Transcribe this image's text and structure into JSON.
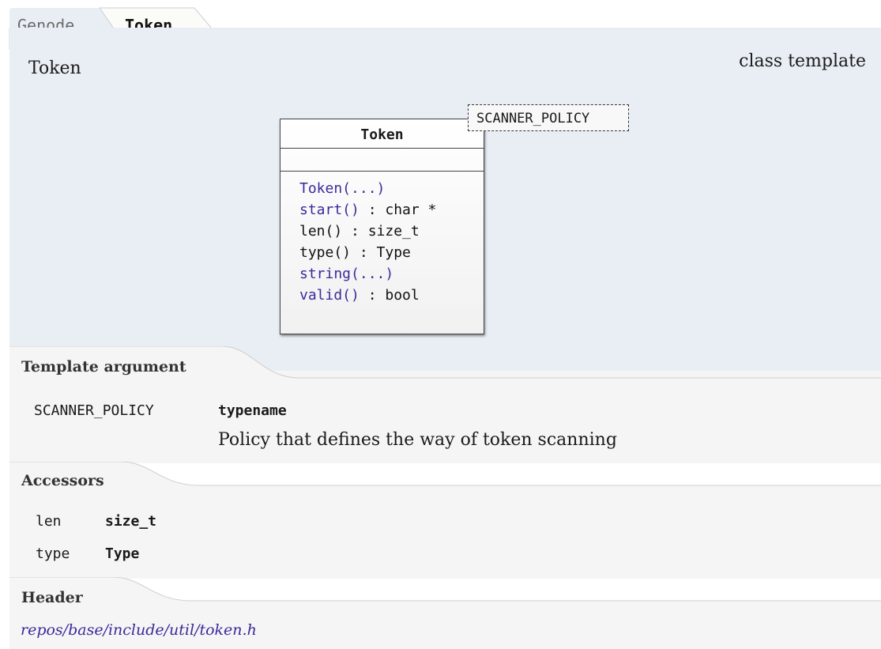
{
  "breadcrumb": {
    "parent": "Genode",
    "current": "Token"
  },
  "class": {
    "name": "Token",
    "kind": "class template"
  },
  "uml": {
    "title": "Token",
    "template_parameter": "SCANNER_POLICY",
    "operations": [
      {
        "name": "Token(...)",
        "type": "",
        "linked": true
      },
      {
        "name": "start()",
        "type": " : char *",
        "linked": true
      },
      {
        "name": "len()",
        "type": " : size_t",
        "linked": false
      },
      {
        "name": "type()",
        "type": " : Type",
        "linked": false
      },
      {
        "name": "string(...)",
        "type": "",
        "linked": true
      },
      {
        "name": "valid()",
        "type": " : bool",
        "linked": true
      }
    ]
  },
  "template_argument": {
    "label": "Template argument",
    "name": "SCANNER_POLICY",
    "type": "typename",
    "description": "Policy that defines the way of token scanning"
  },
  "accessors": {
    "label": "Accessors",
    "items": [
      {
        "name": "len",
        "type": "size_t"
      },
      {
        "name": "type",
        "type": "Type"
      }
    ]
  },
  "header": {
    "label": "Header",
    "path": "repos/base/include/util/token.h"
  },
  "colors": {
    "panel": "#e9eef5",
    "section": "#f5f5f5",
    "link": "#3a2a9a"
  }
}
